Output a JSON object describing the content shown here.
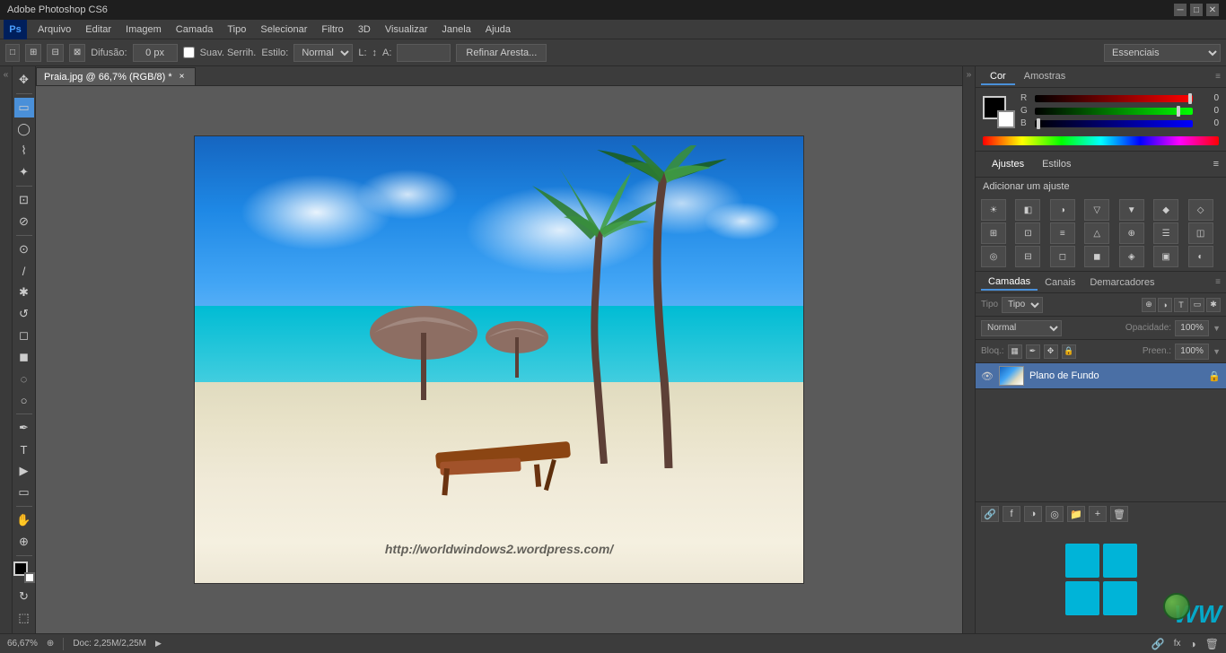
{
  "titlebar": {
    "title": "Adobe Photoshop CS6",
    "controls": [
      "minimize",
      "maximize",
      "close"
    ]
  },
  "menubar": {
    "logo": "Ps",
    "items": [
      "Arquivo",
      "Editar",
      "Imagem",
      "Camada",
      "Tipo",
      "Selecionar",
      "Filtro",
      "3D",
      "Visualizar",
      "Janela",
      "Ajuda"
    ]
  },
  "optionsbar": {
    "diffusion_label": "Difusão:",
    "diffusion_value": "0 px",
    "anti_alias_label": "Suav. Serrih.",
    "style_label": "Estilo:",
    "style_value": "Normal",
    "refinar_label": "Refinar Aresta...",
    "workspace_value": "Essenciais"
  },
  "tab": {
    "filename": "Praia.jpg @ 66,7% (RGB/8) *",
    "close": "×"
  },
  "color_panel": {
    "tab_cor": "Cor",
    "tab_amostras": "Amostras",
    "channel_r": "R",
    "channel_g": "G",
    "channel_b": "B",
    "r_value": "0",
    "g_value": "0",
    "b_value": "0",
    "r_slider_pos": "100%",
    "g_slider_pos": "92%",
    "b_slider_pos": "0%"
  },
  "adjustments_panel": {
    "header": "Ajustes",
    "tab_estilos": "Estilos",
    "add_label": "Adicionar um ajuste",
    "icons": [
      "☀",
      "◧",
      "◑",
      "▽",
      "▼",
      "◆",
      "◇",
      "⊞",
      "⊡",
      "≡",
      "△",
      "⊕",
      "☰",
      "◫",
      "◎",
      "⊟",
      "◻",
      "◼",
      "◈",
      "▣",
      "◐"
    ]
  },
  "layers_panel": {
    "tab_camadas": "Camadas",
    "tab_canais": "Canais",
    "tab_demarcadores": "Demarcadores",
    "filter_label": "Tipo",
    "mode_value": "Normal",
    "opacity_label": "Opacidade:",
    "opacity_value": "100%",
    "lock_label": "Bloq.:",
    "fill_label": "Preen.:",
    "fill_value": "100%",
    "layers": [
      {
        "name": "Plano de Fundo",
        "visible": true,
        "locked": true
      }
    ]
  },
  "watermark": {
    "url": "http://worldwindows2.wordpress.com/"
  },
  "statusbar": {
    "zoom": "66,67%",
    "doc_info": "Doc: 2,25M/2,25M"
  },
  "tools": [
    {
      "name": "move",
      "icon": "✥"
    },
    {
      "name": "marquee-rect",
      "icon": "▭"
    },
    {
      "name": "marquee-ellipse",
      "icon": "◯"
    },
    {
      "name": "lasso",
      "icon": "⌇"
    },
    {
      "name": "magic-wand",
      "icon": "✦"
    },
    {
      "name": "crop",
      "icon": "⊡"
    },
    {
      "name": "eyedropper",
      "icon": "⊘"
    },
    {
      "name": "healing-brush",
      "icon": "⊙"
    },
    {
      "name": "brush",
      "icon": "/"
    },
    {
      "name": "clone-stamp",
      "icon": "✱"
    },
    {
      "name": "history-brush",
      "icon": "↺"
    },
    {
      "name": "eraser",
      "icon": "▭"
    },
    {
      "name": "gradient",
      "icon": "◼"
    },
    {
      "name": "blur",
      "icon": "◌"
    },
    {
      "name": "dodge",
      "icon": "○"
    },
    {
      "name": "pen",
      "icon": "✒"
    },
    {
      "name": "text",
      "icon": "T"
    },
    {
      "name": "path-select",
      "icon": "▶"
    },
    {
      "name": "shape",
      "icon": "▭"
    },
    {
      "name": "hand",
      "icon": "✋"
    },
    {
      "name": "zoom",
      "icon": "⊕"
    },
    {
      "name": "fg-color",
      "icon": "■"
    },
    {
      "name": "rotate-view",
      "icon": "↻"
    }
  ]
}
